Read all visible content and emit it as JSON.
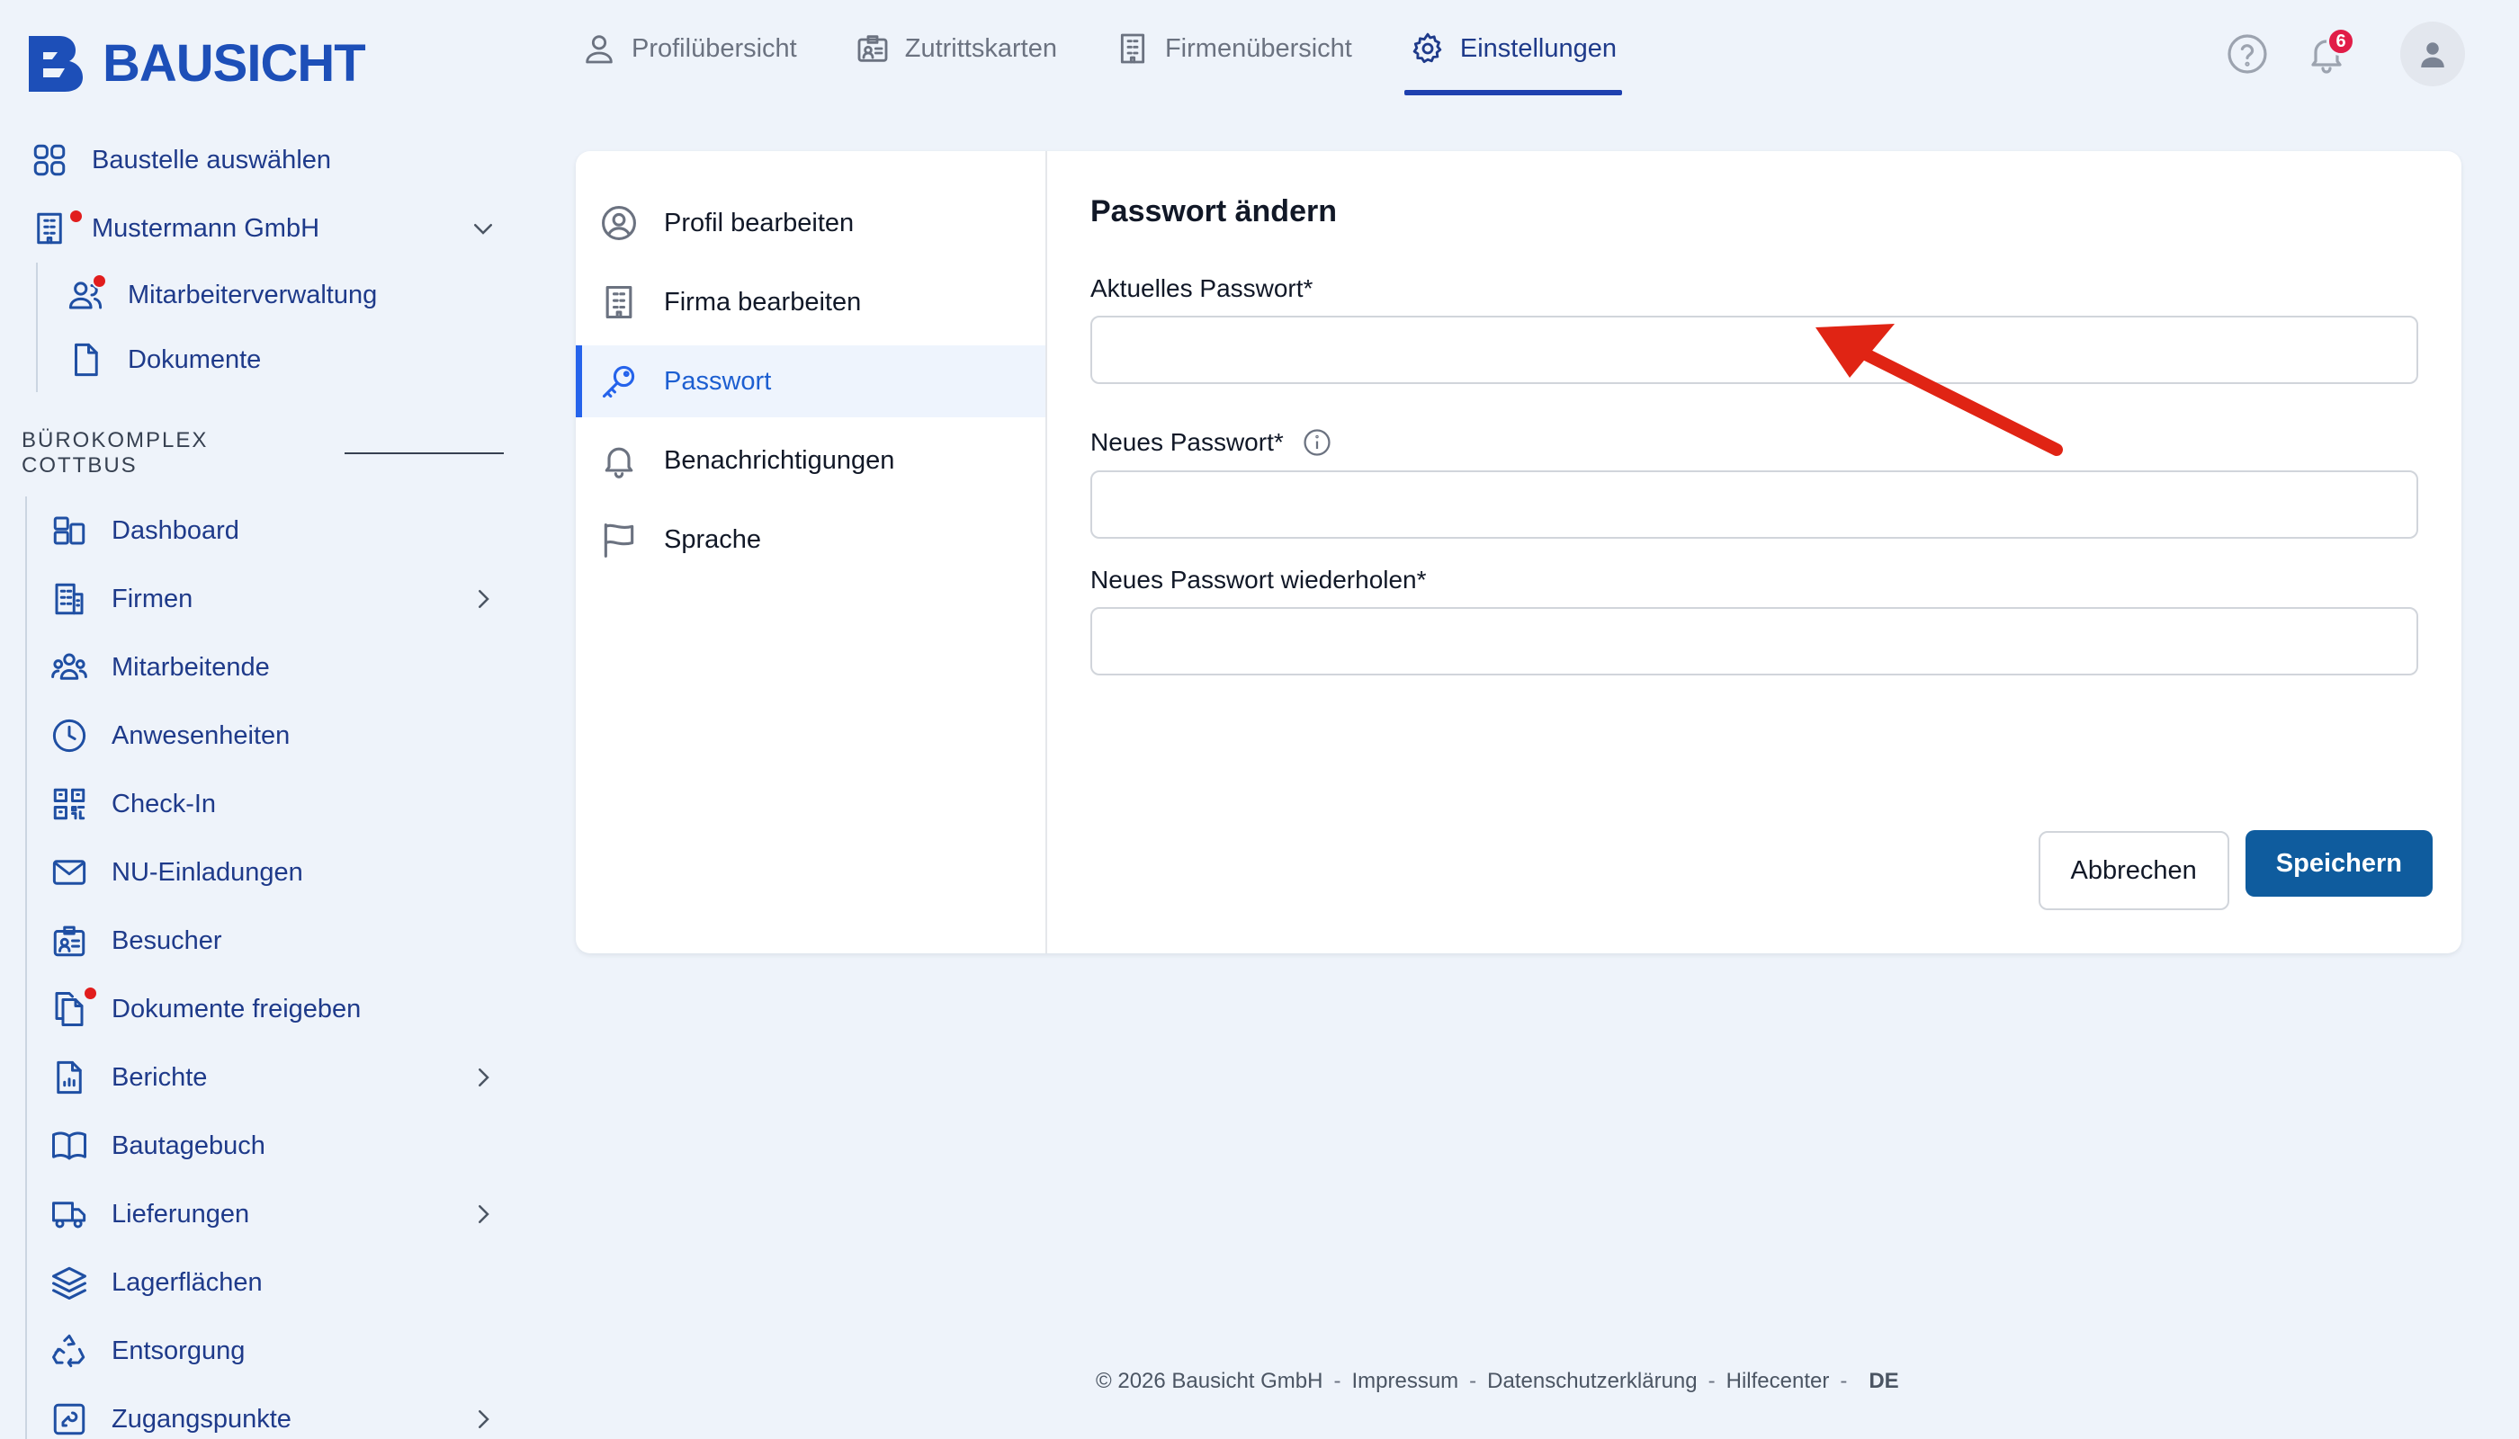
{
  "app": {
    "brand": "BAUSICHT"
  },
  "topnav": {
    "tabs": [
      {
        "label": "Profilübersicht",
        "icon": "user-icon"
      },
      {
        "label": "Zutrittskarten",
        "icon": "id-card-icon"
      },
      {
        "label": "Firmenübersicht",
        "icon": "building-icon"
      },
      {
        "label": "Einstellungen",
        "icon": "gear-icon",
        "active": true
      }
    ],
    "notification_count": "6"
  },
  "sidebar": {
    "select_site": "Baustelle auswählen",
    "company": "Mustermann GmbH",
    "company_items": [
      {
        "label": "Mitarbeiterverwaltung",
        "icon": "users-icon"
      },
      {
        "label": "Dokumente",
        "icon": "document-icon"
      }
    ],
    "section_title": "BÜROKOMPLEX COTTBUS",
    "items": [
      {
        "label": "Dashboard",
        "icon": "dashboard-icon"
      },
      {
        "label": "Firmen",
        "icon": "building-icon"
      },
      {
        "label": "Mitarbeitende",
        "icon": "team-icon"
      },
      {
        "label": "Anwesenheiten",
        "icon": "clock-icon"
      },
      {
        "label": "Check-In",
        "icon": "qr-code-icon"
      },
      {
        "label": "NU-Einladungen",
        "icon": "mail-icon"
      },
      {
        "label": "Besucher",
        "icon": "visitor-badge-icon"
      },
      {
        "label": "Dokumente freigeben",
        "icon": "documents-icon"
      },
      {
        "label": "Berichte",
        "icon": "report-icon"
      },
      {
        "label": "Bautagebuch",
        "icon": "book-icon"
      },
      {
        "label": "Lieferungen",
        "icon": "truck-icon"
      },
      {
        "label": "Lagerflächen",
        "icon": "layers-icon"
      },
      {
        "label": "Entsorgung",
        "icon": "recycle-icon"
      },
      {
        "label": "Zugangspunkte",
        "icon": "access-point-icon"
      }
    ]
  },
  "settings_menu": [
    {
      "label": "Profil bearbeiten",
      "icon": "user-circle-icon"
    },
    {
      "label": "Firma bearbeiten",
      "icon": "building-icon"
    },
    {
      "label": "Passwort",
      "icon": "key-icon",
      "active": true
    },
    {
      "label": "Benachrichtigungen",
      "icon": "bell-icon"
    },
    {
      "label": "Sprache",
      "icon": "flag-icon"
    }
  ],
  "form": {
    "title": "Passwort ändern",
    "current_label": "Aktuelles Passwort*",
    "current_value": "",
    "new_label": "Neues Passwort*",
    "new_value": "",
    "repeat_label": "Neues Passwort wiederholen*",
    "repeat_value": "",
    "cancel": "Abbrechen",
    "save": "Speichern"
  },
  "footer": {
    "copyright": "© 2026 Bausicht GmbH",
    "imprint": "Impressum",
    "privacy": "Datenschutzerklärung",
    "help": "Hilfecenter",
    "language": "DE"
  },
  "colors": {
    "brand": "#1d4fb8",
    "primary_button": "#0f5c9e",
    "badge": "#e11d48",
    "arrow": "#e02414"
  }
}
